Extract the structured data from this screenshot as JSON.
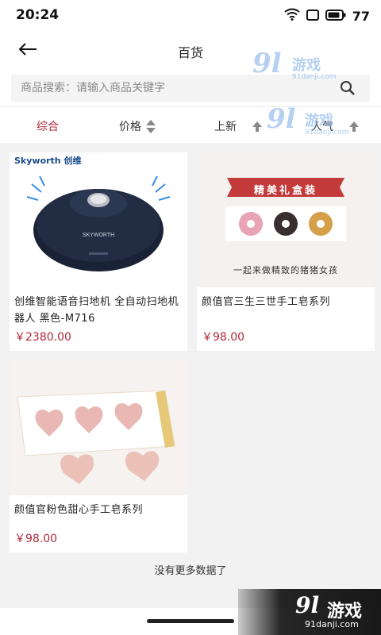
{
  "status_bar": {
    "time": "20:24",
    "battery": "77"
  },
  "header": {
    "title": "百货"
  },
  "search": {
    "placeholder": "商品搜索：请输入商品关键字"
  },
  "sort": {
    "items": [
      {
        "label": "综合",
        "active": true
      },
      {
        "label": "价格"
      },
      {
        "label": "上新"
      },
      {
        "label": "人气"
      }
    ]
  },
  "products": [
    {
      "brand": "Skyworth 创维",
      "title": "创维智能语音扫地机 全自动扫地机器人 黑色-M716",
      "price": "￥2380.00"
    },
    {
      "banner": "精美礼盒装",
      "caption": "一起来做精致的猪猪女孩",
      "title": "颜值官三生三世手工皂系列",
      "price": "￥98.00"
    },
    {
      "title": "颜值官粉色甜心手工皂系列",
      "price": "￥98.00"
    }
  ],
  "footer": {
    "no_more": "没有更多数据了"
  },
  "watermark": {
    "logo": "9l",
    "name": "游戏",
    "url": "91danji.com"
  },
  "colors": {
    "accent": "#b0283a",
    "background": "#f2f2f2"
  }
}
